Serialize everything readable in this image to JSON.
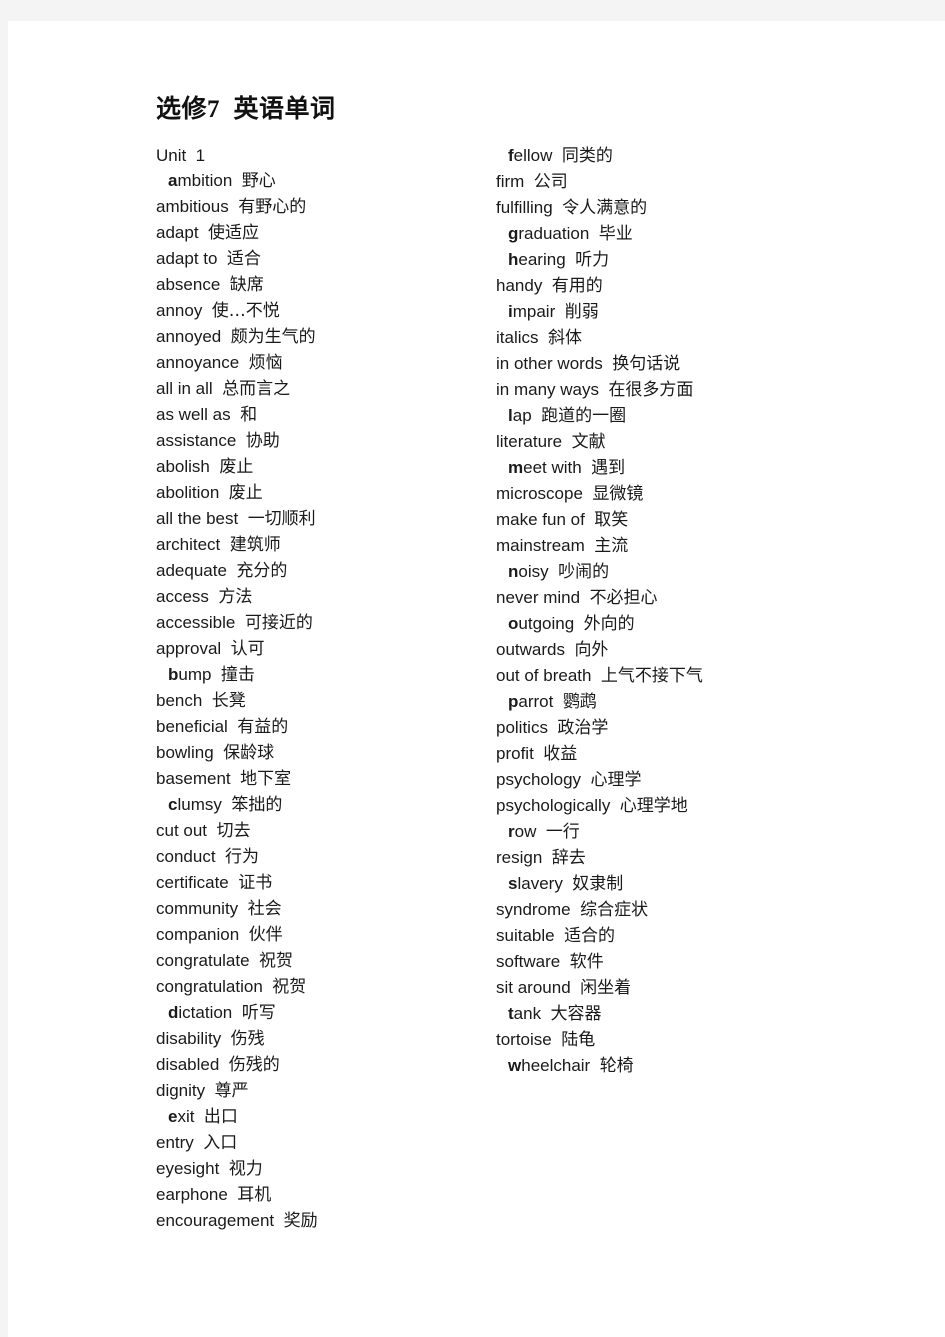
{
  "document": {
    "title": "选修7  英语单词",
    "unit_label": "Unit  1"
  },
  "columns": {
    "left": [
      {
        "term": "ambition",
        "meaning": "野心",
        "bold_initial": true,
        "indent": true
      },
      {
        "term": "ambitious",
        "meaning": "有野心的",
        "bold_initial": false,
        "indent": false
      },
      {
        "term": "adapt",
        "meaning": "使适应",
        "bold_initial": false,
        "indent": false
      },
      {
        "term": "adapt to",
        "meaning": "适合",
        "bold_initial": false,
        "indent": false
      },
      {
        "term": "absence",
        "meaning": "缺席",
        "bold_initial": false,
        "indent": false
      },
      {
        "term": "annoy",
        "meaning": "使…不悦",
        "bold_initial": false,
        "indent": false
      },
      {
        "term": "annoyed",
        "meaning": "颇为生气的",
        "bold_initial": false,
        "indent": false
      },
      {
        "term": "annoyance",
        "meaning": "烦恼",
        "bold_initial": false,
        "indent": false
      },
      {
        "term": "all in all",
        "meaning": "总而言之",
        "bold_initial": false,
        "indent": false
      },
      {
        "term": "as well as",
        "meaning": "和",
        "bold_initial": false,
        "indent": false
      },
      {
        "term": "assistance",
        "meaning": "协助",
        "bold_initial": false,
        "indent": false
      },
      {
        "term": "abolish",
        "meaning": "废止",
        "bold_initial": false,
        "indent": false
      },
      {
        "term": "abolition",
        "meaning": "废止",
        "bold_initial": false,
        "indent": false
      },
      {
        "term": "all the best",
        "meaning": "一切顺利",
        "bold_initial": false,
        "indent": false
      },
      {
        "term": "architect",
        "meaning": "建筑师",
        "bold_initial": false,
        "indent": false
      },
      {
        "term": "adequate",
        "meaning": "充分的",
        "bold_initial": false,
        "indent": false
      },
      {
        "term": "access",
        "meaning": "方法",
        "bold_initial": false,
        "indent": false
      },
      {
        "term": "accessible",
        "meaning": "可接近的",
        "bold_initial": false,
        "indent": false
      },
      {
        "term": "approval",
        "meaning": "认可",
        "bold_initial": false,
        "indent": false
      },
      {
        "term": "bump",
        "meaning": "撞击",
        "bold_initial": true,
        "indent": true
      },
      {
        "term": "bench",
        "meaning": "长凳",
        "bold_initial": false,
        "indent": false
      },
      {
        "term": "beneficial",
        "meaning": "有益的",
        "bold_initial": false,
        "indent": false
      },
      {
        "term": "bowling",
        "meaning": "保龄球",
        "bold_initial": false,
        "indent": false
      },
      {
        "term": "basement",
        "meaning": "地下室",
        "bold_initial": false,
        "indent": false
      },
      {
        "term": "clumsy",
        "meaning": "笨拙的",
        "bold_initial": true,
        "indent": true
      },
      {
        "term": "cut out",
        "meaning": "切去",
        "bold_initial": false,
        "indent": false
      },
      {
        "term": "conduct",
        "meaning": "行为",
        "bold_initial": false,
        "indent": false
      },
      {
        "term": "certificate",
        "meaning": "证书",
        "bold_initial": false,
        "indent": false
      },
      {
        "term": "community",
        "meaning": "社会",
        "bold_initial": false,
        "indent": false
      },
      {
        "term": "companion",
        "meaning": "伙伴",
        "bold_initial": false,
        "indent": false
      },
      {
        "term": "congratulate",
        "meaning": "祝贺",
        "bold_initial": false,
        "indent": false
      },
      {
        "term": "congratulation",
        "meaning": "祝贺",
        "bold_initial": false,
        "indent": false
      },
      {
        "term": "dictation",
        "meaning": "听写",
        "bold_initial": true,
        "indent": true
      },
      {
        "term": "disability",
        "meaning": "伤残",
        "bold_initial": false,
        "indent": false
      },
      {
        "term": "disabled",
        "meaning": "伤残的",
        "bold_initial": false,
        "indent": false
      },
      {
        "term": "dignity",
        "meaning": "尊严",
        "bold_initial": false,
        "indent": false
      },
      {
        "term": "exit",
        "meaning": "出口",
        "bold_initial": true,
        "indent": true
      },
      {
        "term": "entry",
        "meaning": "入口",
        "bold_initial": false,
        "indent": false
      },
      {
        "term": "eyesight",
        "meaning": "视力",
        "bold_initial": false,
        "indent": false
      },
      {
        "term": "earphone",
        "meaning": "耳机",
        "bold_initial": false,
        "indent": false
      },
      {
        "term": "encouragement",
        "meaning": "奖励",
        "bold_initial": false,
        "indent": false
      }
    ],
    "right": [
      {
        "term": "fellow",
        "meaning": "同类的",
        "bold_initial": true,
        "indent": true
      },
      {
        "term": "firm",
        "meaning": "公司",
        "bold_initial": false,
        "indent": false
      },
      {
        "term": "fulfilling",
        "meaning": "令人满意的",
        "bold_initial": false,
        "indent": false
      },
      {
        "term": "graduation",
        "meaning": "毕业",
        "bold_initial": true,
        "indent": true
      },
      {
        "term": "hearing",
        "meaning": "听力",
        "bold_initial": true,
        "indent": true
      },
      {
        "term": "handy",
        "meaning": "有用的",
        "bold_initial": false,
        "indent": false
      },
      {
        "term": "impair",
        "meaning": "削弱",
        "bold_initial": true,
        "indent": true
      },
      {
        "term": "italics",
        "meaning": "斜体",
        "bold_initial": false,
        "indent": false
      },
      {
        "term": "in other words",
        "meaning": "换句话说",
        "bold_initial": false,
        "indent": false
      },
      {
        "term": "in many ways",
        "meaning": "在很多方面",
        "bold_initial": false,
        "indent": false
      },
      {
        "term": "lap",
        "meaning": "跑道的一圈",
        "bold_initial": true,
        "indent": true
      },
      {
        "term": "literature",
        "meaning": "文献",
        "bold_initial": false,
        "indent": false
      },
      {
        "term": "meet with",
        "meaning": "遇到",
        "bold_initial": true,
        "indent": true
      },
      {
        "term": "microscope",
        "meaning": "显微镜",
        "bold_initial": false,
        "indent": false
      },
      {
        "term": "make fun of",
        "meaning": "取笑",
        "bold_initial": false,
        "indent": false
      },
      {
        "term": "mainstream",
        "meaning": "主流",
        "bold_initial": false,
        "indent": false
      },
      {
        "term": "noisy",
        "meaning": "吵闹的",
        "bold_initial": true,
        "indent": true
      },
      {
        "term": "never mind",
        "meaning": "不必担心",
        "bold_initial": false,
        "indent": false
      },
      {
        "term": "outgoing",
        "meaning": "外向的",
        "bold_initial": true,
        "indent": true
      },
      {
        "term": "outwards",
        "meaning": "向外",
        "bold_initial": false,
        "indent": false
      },
      {
        "term": "out of breath",
        "meaning": "上气不接下气",
        "bold_initial": false,
        "indent": false
      },
      {
        "term": "parrot",
        "meaning": "鹦鹉",
        "bold_initial": true,
        "indent": true
      },
      {
        "term": "politics",
        "meaning": "政治学",
        "bold_initial": false,
        "indent": false
      },
      {
        "term": "profit",
        "meaning": "收益",
        "bold_initial": false,
        "indent": false
      },
      {
        "term": "psychology",
        "meaning": "心理学",
        "bold_initial": false,
        "indent": false
      },
      {
        "term": "psychologically",
        "meaning": "心理学地",
        "bold_initial": false,
        "indent": false
      },
      {
        "term": "row",
        "meaning": "一行",
        "bold_initial": true,
        "indent": true
      },
      {
        "term": "resign",
        "meaning": "辞去",
        "bold_initial": false,
        "indent": false
      },
      {
        "term": "slavery",
        "meaning": "奴隶制",
        "bold_initial": true,
        "indent": true
      },
      {
        "term": "syndrome",
        "meaning": "综合症状",
        "bold_initial": false,
        "indent": false
      },
      {
        "term": "suitable",
        "meaning": "适合的",
        "bold_initial": false,
        "indent": false
      },
      {
        "term": "software",
        "meaning": "软件",
        "bold_initial": false,
        "indent": false
      },
      {
        "term": "sit around",
        "meaning": "闲坐着",
        "bold_initial": false,
        "indent": false
      },
      {
        "term": "tank",
        "meaning": "大容器",
        "bold_initial": true,
        "indent": true
      },
      {
        "term": "tortoise",
        "meaning": "陆龟",
        "bold_initial": false,
        "indent": false
      },
      {
        "term": "wheelchair",
        "meaning": "轮椅",
        "bold_initial": true,
        "indent": true
      }
    ]
  }
}
